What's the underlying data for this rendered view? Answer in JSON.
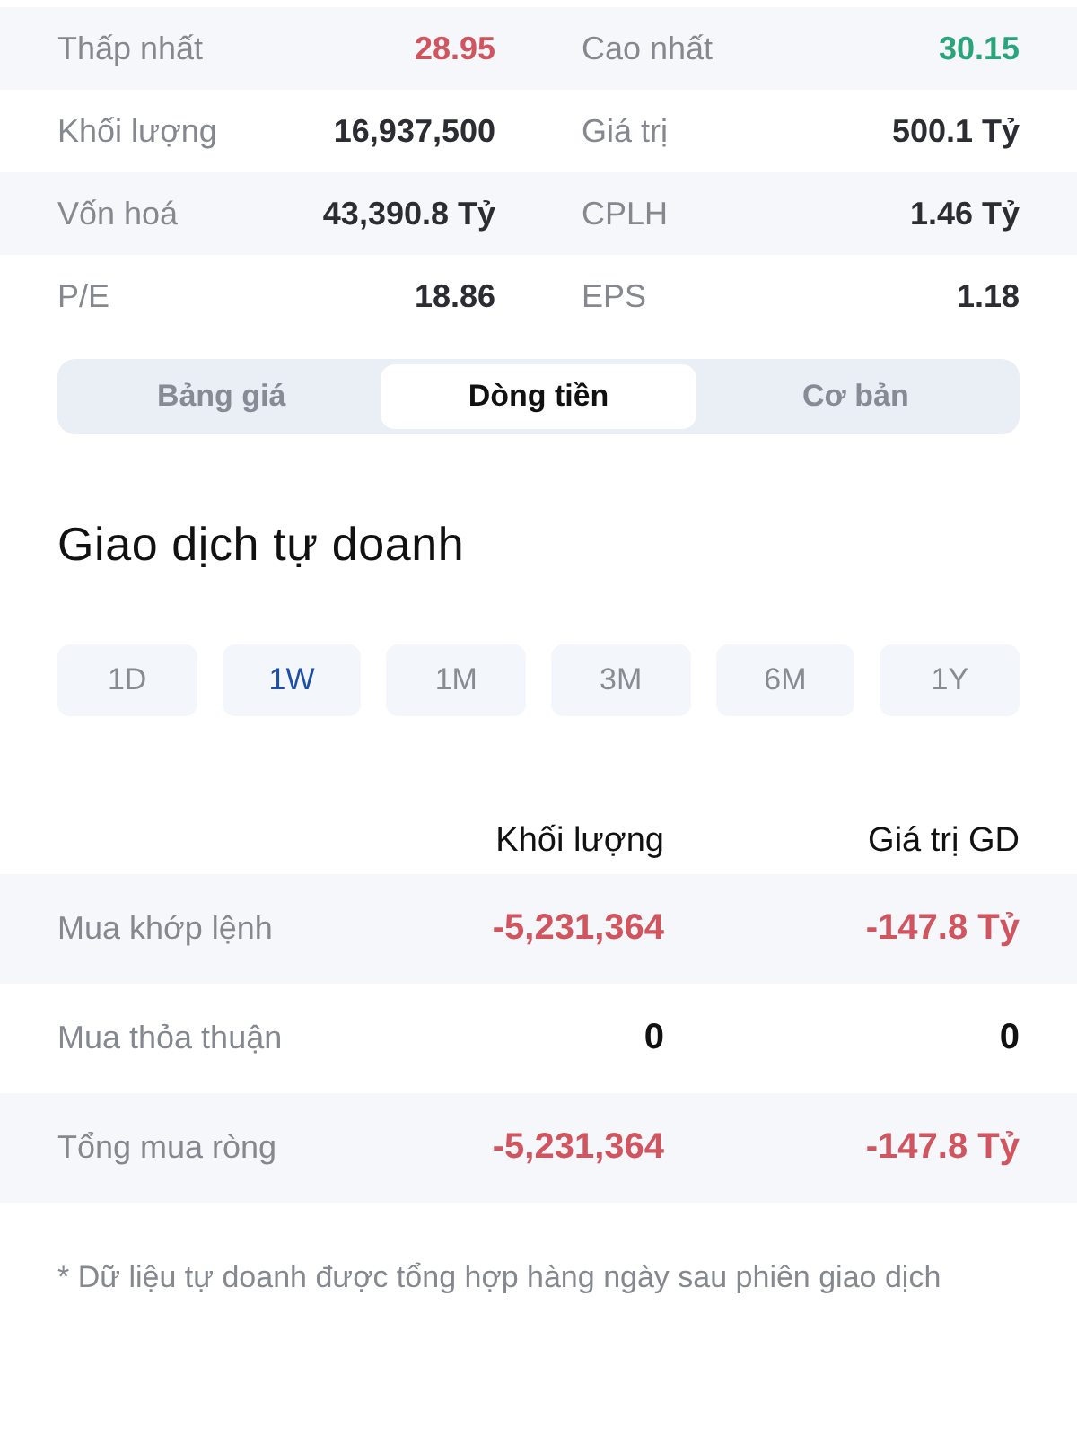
{
  "stats": [
    {
      "label": "Thấp nhất",
      "value": "28.95",
      "color": "#d0555f"
    },
    {
      "label": "Cao nhất",
      "value": "30.15",
      "color": "#2aa57a"
    },
    {
      "label": "Khối lượng",
      "value": "16,937,500",
      "color": "#2b2d33"
    },
    {
      "label": "Giá trị",
      "value": "500.1 Tỷ",
      "color": "#2b2d33"
    },
    {
      "label": "Vốn hoá",
      "value": "43,390.8 Tỷ",
      "color": "#2b2d33"
    },
    {
      "label": "CPLH",
      "value": "1.46 Tỷ",
      "color": "#2b2d33"
    },
    {
      "label": "P/E",
      "value": "18.86",
      "color": "#2b2d33"
    },
    {
      "label": "EPS",
      "value": "1.18",
      "color": "#2b2d33"
    }
  ],
  "tabs": [
    {
      "label": "Bảng giá",
      "selected": false
    },
    {
      "label": "Dòng tiền",
      "selected": true
    },
    {
      "label": "Cơ bản",
      "selected": false
    }
  ],
  "section_title": "Giao dịch tự doanh",
  "periods": [
    {
      "label": "1D",
      "selected": false
    },
    {
      "label": "1W",
      "selected": true
    },
    {
      "label": "1M",
      "selected": false
    },
    {
      "label": "3M",
      "selected": false
    },
    {
      "label": "6M",
      "selected": false
    },
    {
      "label": "1Y",
      "selected": false
    }
  ],
  "table": {
    "columns": [
      "Khối lượng",
      "Giá trị GD"
    ],
    "rows": [
      {
        "label": "Mua khớp lệnh",
        "cells": [
          {
            "text": "-5,231,364",
            "color": "#d0555f"
          },
          {
            "text": "-147.8 Tỷ",
            "color": "#d0555f"
          }
        ]
      },
      {
        "label": "Mua thỏa thuận",
        "cells": [
          {
            "text": "0",
            "color": "#111111"
          },
          {
            "text": "0",
            "color": "#111111"
          }
        ]
      },
      {
        "label": "Tổng mua ròng",
        "cells": [
          {
            "text": "-5,231,364",
            "color": "#d0555f"
          },
          {
            "text": "-147.8 Tỷ",
            "color": "#d0555f"
          }
        ]
      }
    ]
  },
  "footnote": "* Dữ liệu tự doanh được tổng hợp hàng ngày sau phiên giao dịch"
}
